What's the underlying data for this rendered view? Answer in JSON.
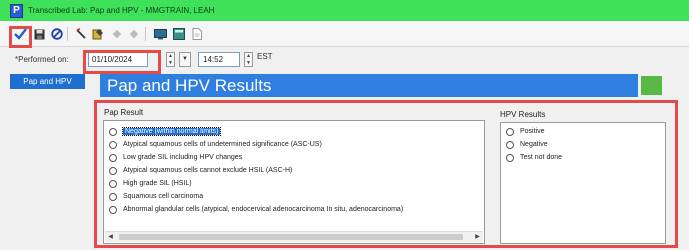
{
  "window": {
    "app_icon_letter": "P",
    "title": "Transcribed Lab: Pap and HPV - MMGTRAIN, LEAH"
  },
  "toolbar": {
    "icons": [
      "checkmark-icon",
      "save-icon",
      "cancel-icon",
      "tool-icon",
      "notes-icon",
      "previous-icon",
      "next-icon",
      "monitor-icon",
      "calculator-icon",
      "document-icon"
    ]
  },
  "performed": {
    "label": "*Performed on:",
    "date": "01/10/2024",
    "time": "14:52",
    "timezone": "EST"
  },
  "nav": {
    "items": [
      {
        "label": "Pap and HPV",
        "selected": true
      }
    ]
  },
  "section": {
    "title": "Pap and HPV Results"
  },
  "pap": {
    "label": "Pap Result",
    "options": [
      "Negative (within normal limits)",
      "Atypical squamous cells of undetermined significance (ASC-US)",
      "Low grade SIL including HPV changes",
      "Atypical squamous cells cannot exclude HSIL (ASC-H)",
      "High grade SIL (HSIL)",
      "Squamous cell carcinoma",
      "Abnormal glandular cells (atypical, endocervical adenocarcinoma In situ, adenocarcinoma)"
    ],
    "selected_index": 0
  },
  "hpv": {
    "label": "HPV Results",
    "options": [
      "Positive",
      "Negative",
      "Test not done"
    ]
  },
  "colors": {
    "title_bar": "#3fe15a",
    "accent_blue": "#2f7fe0",
    "highlight_red": "#e34b4b",
    "status_green": "#58b947"
  }
}
